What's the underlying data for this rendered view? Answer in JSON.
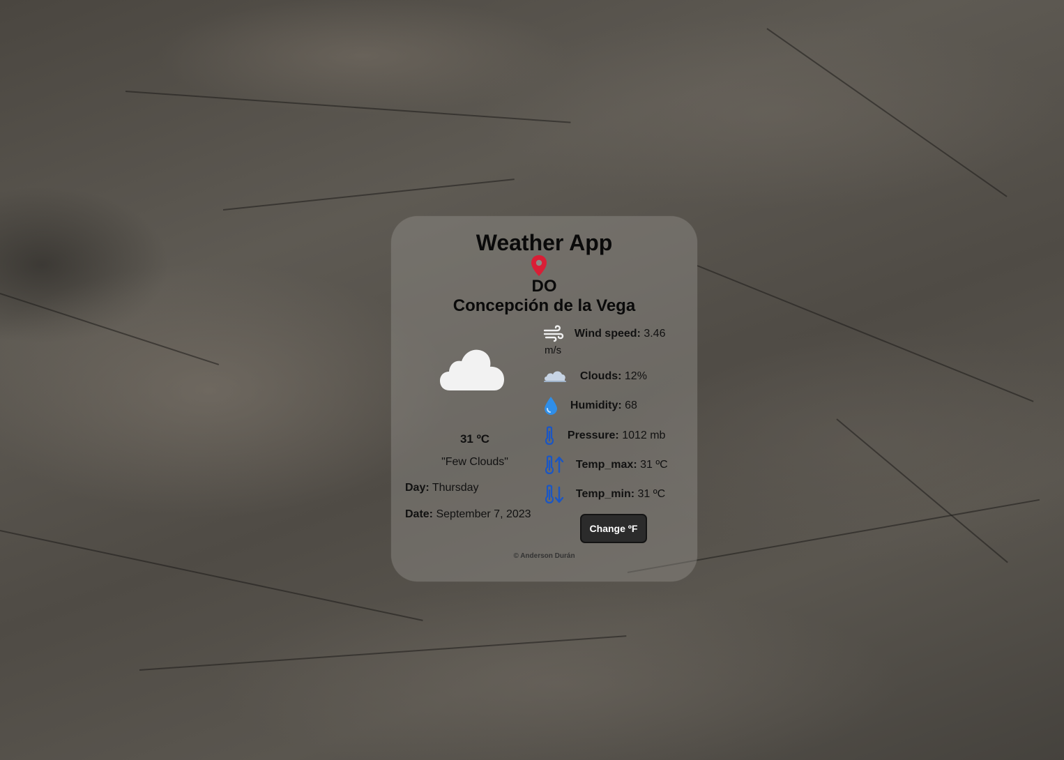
{
  "app": {
    "title": "Weather App"
  },
  "location": {
    "country": "DO",
    "city": "Concepción de la Vega"
  },
  "weather": {
    "temperature": "31 ºC",
    "description": "\"Few Clouds\"",
    "day_label": "Day:",
    "day_value": "Thursday",
    "date_label": "Date:",
    "date_value": "September 7, 2023"
  },
  "stats": {
    "wind_label": "Wind speed:",
    "wind_value": "3.46",
    "wind_unit": "m/s",
    "clouds_label": "Clouds:",
    "clouds_value": "12%",
    "humidity_label": "Humidity:",
    "humidity_value": "68",
    "pressure_label": "Pressure:",
    "pressure_value": "1012 mb",
    "temp_max_label": "Temp_max:",
    "temp_max_value": "31 ºC",
    "temp_min_label": "Temp_min:",
    "temp_min_value": "31 ºC"
  },
  "controls": {
    "change_unit_label": "Change ºF"
  },
  "footer": {
    "credit": "© Anderson Durán"
  },
  "colors": {
    "pin": "#d91e36",
    "icon_blue": "#1a56c4",
    "drop_blue": "#2f8ee8",
    "button_bg": "#2b2b2b"
  },
  "icons": {
    "location": "map-pin-icon",
    "weather": "cloud-icon",
    "wind": "wind-icon",
    "clouds": "clouds-icon",
    "humidity": "water-drop-icon",
    "pressure": "thermometer-icon",
    "temp_max": "thermometer-up-icon",
    "temp_min": "thermometer-down-icon"
  }
}
